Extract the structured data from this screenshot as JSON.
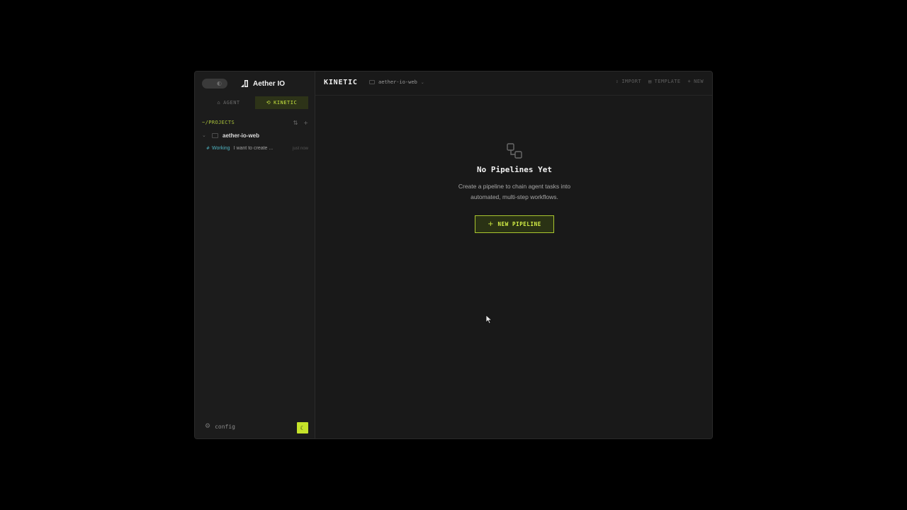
{
  "sidebar": {
    "brand": {
      "name": "Aether IO",
      "logo_icon": "brand-logo-icon"
    },
    "toggle_icon": "sidebar-toggle-icon",
    "mode_tabs": [
      {
        "label": "AGENT",
        "icon": "agent-icon",
        "active": false
      },
      {
        "label": "KINETIC",
        "icon": "kinetic-icon",
        "active": true
      }
    ],
    "projects": {
      "label": "~/PROJECTS",
      "sort_icon": "sort-icon",
      "add_icon": "plus-icon",
      "items": [
        {
          "name": "aether-io-web",
          "expanded": true,
          "sessions": [
            {
              "status": "Working",
              "text": "I want to create ...",
              "time": "just now"
            }
          ]
        }
      ]
    },
    "config_label": "config",
    "theme_icon": "moon-icon"
  },
  "main": {
    "title": "KINETIC",
    "project_selector": "aether-io-web",
    "actions": [
      {
        "label": "IMPORT",
        "icon": "upload-icon"
      },
      {
        "label": "TEMPLATE",
        "icon": "template-icon"
      },
      {
        "label": "NEW",
        "icon": "plus-icon"
      }
    ],
    "empty_state": {
      "title": "No Pipelines Yet",
      "description_line1": "Create a pipeline to chain agent tasks into",
      "description_line2": "automated, multi-step workflows.",
      "button_label": "NEW PIPELINE"
    }
  },
  "colors": {
    "accent": "#c8e640",
    "accent_dark_bg": "#2d3318",
    "status_working": "#4fb3c0",
    "window_bg": "#1a1a1a",
    "page_bg": "#000000"
  }
}
